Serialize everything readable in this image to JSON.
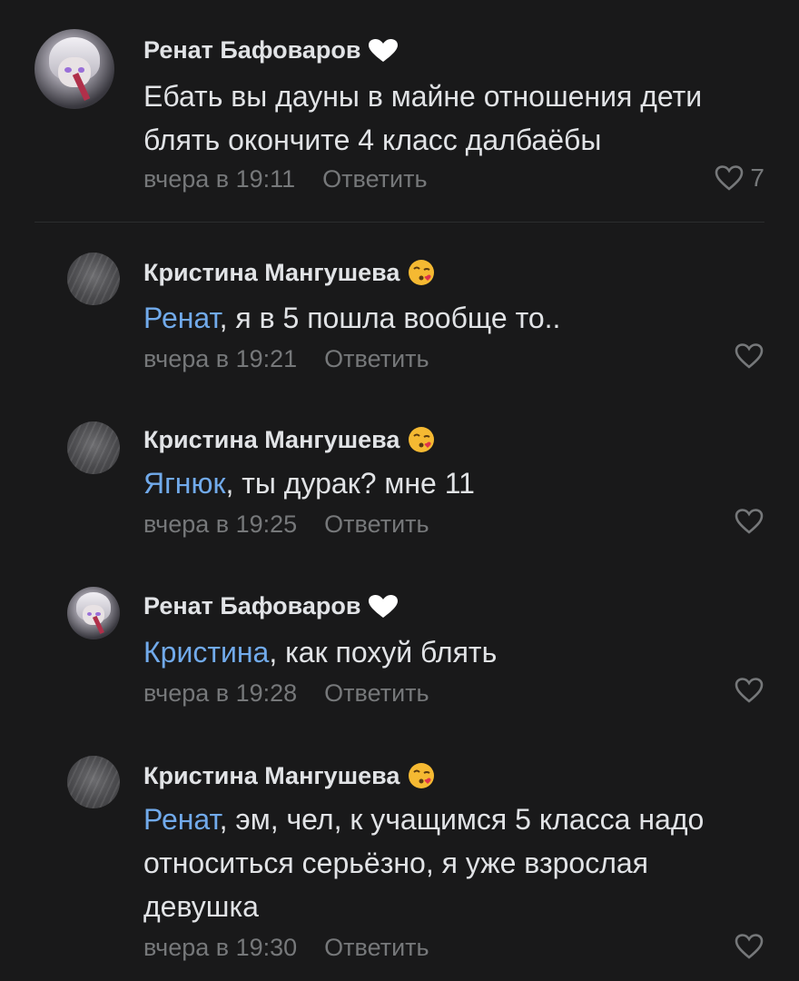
{
  "comments": [
    {
      "author": "Ренат Бафоваров",
      "badge": "white-heart-icon",
      "mention": "",
      "text": "Ебать вы дауны в майне отношения дети блять окончите 4 класс далбаёбы",
      "time": "вчера в 19:11",
      "reply_label": "Ответить",
      "likes": "7"
    },
    {
      "author": "Кристина Мангушева",
      "badge": "kissing-face-emoji",
      "mention": "Ренат",
      "text": ", я в 5 пошла вообще то..",
      "time": "вчера в 19:21",
      "reply_label": "Ответить",
      "likes": ""
    },
    {
      "author": "Кристина Мангушева",
      "badge": "kissing-face-emoji",
      "mention": "Ягнюк",
      "text": ", ты дурак? мне 11",
      "time": "вчера в 19:25",
      "reply_label": "Ответить",
      "likes": ""
    },
    {
      "author": "Ренат Бафоваров",
      "badge": "white-heart-icon",
      "mention": "Кристина",
      "text": ", как похуй блять",
      "time": "вчера в 19:28",
      "reply_label": "Ответить",
      "likes": ""
    },
    {
      "author": "Кристина Мангушева",
      "badge": "kissing-face-emoji",
      "mention": "Ренат",
      "text": ", эм, чел, к учащимся 5 класса надо относиться серьёзно, я уже взрослая девушка",
      "time": "вчера в 19:30",
      "reply_label": "Ответить",
      "likes": ""
    }
  ],
  "colors": {
    "background": "#19191a",
    "text": "#e1e3e6",
    "secondary": "#76787a",
    "link": "#71aaeb"
  }
}
